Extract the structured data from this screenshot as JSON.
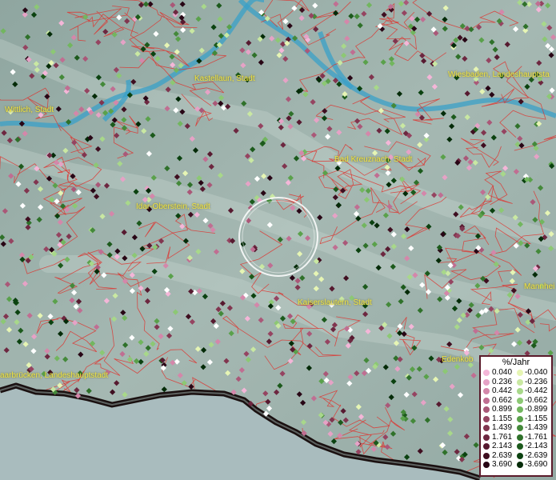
{
  "map": {
    "cities": [
      {
        "id": "kastellaun",
        "label": "Kastellaun, Stadt"
      },
      {
        "id": "wiesbaden",
        "label": "Wiesbaden, Landeshauptsta"
      },
      {
        "id": "wittlich",
        "label": "Wittlich, Stadt"
      },
      {
        "id": "bad-kreuznach",
        "label": "Bad Kreuznach, Stadt"
      },
      {
        "id": "idar-oberstein",
        "label": "Idar-Oberstein, Stadt"
      },
      {
        "id": "kaiserslautern",
        "label": "Kaiserslautern, Stadt"
      },
      {
        "id": "mannheim",
        "label": "Mannhei"
      },
      {
        "id": "saarbruecken",
        "label": "aarbrücken, Landeshauptstadt"
      },
      {
        "id": "edenkoben",
        "label": "Edenkob"
      }
    ],
    "colors": {
      "terrain": "#9fb3ad",
      "boundaries": "#e0302a",
      "rivers": "#3aa0c8",
      "pos_palette": [
        "#f4b6d8",
        "#e6a2c6",
        "#d487aa",
        "#c06e92",
        "#aa5878",
        "#954461",
        "#81354f",
        "#6d2740",
        "#571a30",
        "#3f0e20",
        "#280615"
      ],
      "neg_palette": [
        "#e6f5b4",
        "#c9e8a2",
        "#a8d88a",
        "#8cc874",
        "#72b65f",
        "#5aa14b",
        "#44893a",
        "#2f712a",
        "#1c5a1c",
        "#0b4210",
        "#042b08"
      ]
    }
  },
  "legend": {
    "title": "%/Jahr",
    "positive": [
      "0.040",
      "0.236",
      "0.442",
      "0.662",
      "0.899",
      "1.155",
      "1.439",
      "1.761",
      "2.143",
      "2.639",
      "3.690"
    ],
    "negative": [
      "-0.040",
      "-0.236",
      "-0.442",
      "-0.662",
      "-0.899",
      "-1.155",
      "-1.439",
      "-1.761",
      "-2.143",
      "-2.639",
      "-3.690"
    ]
  }
}
